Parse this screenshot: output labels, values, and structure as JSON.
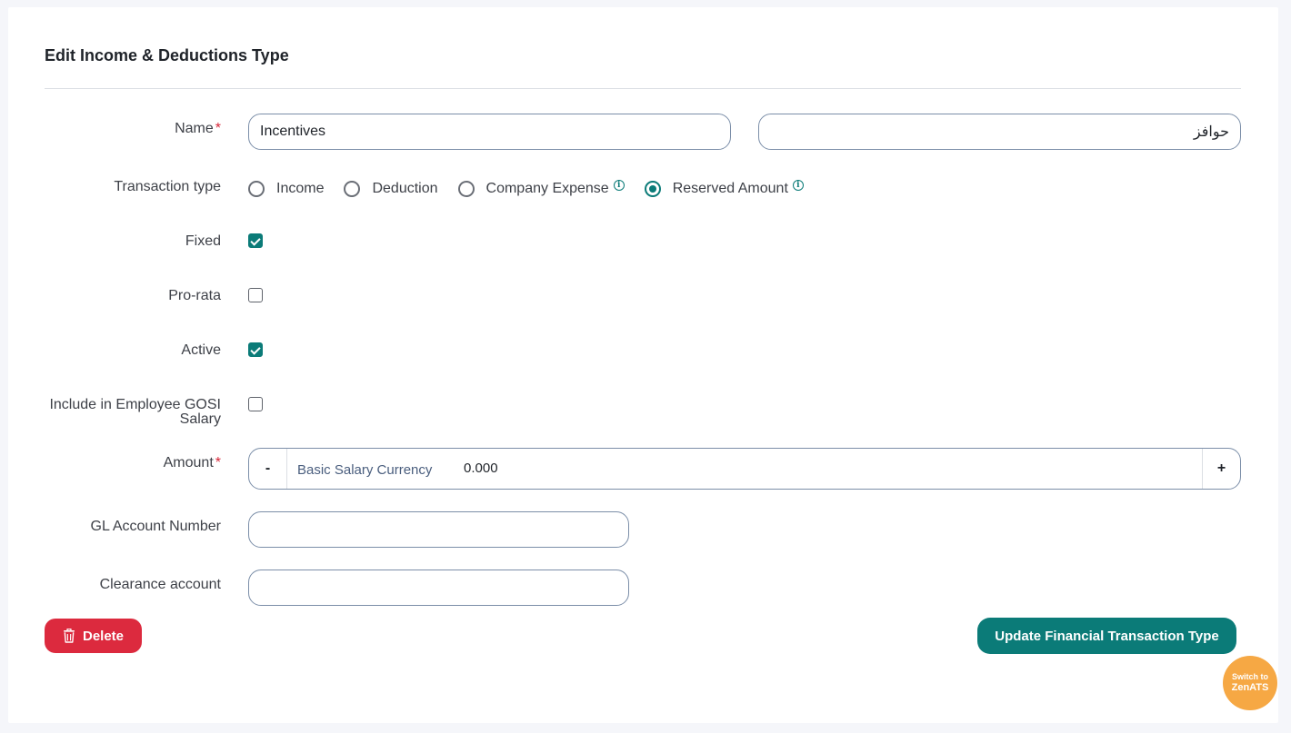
{
  "page": {
    "title": "Edit Income & Deductions Type"
  },
  "form": {
    "name": {
      "label": "Name",
      "required_mark": "*",
      "value_en": "Incentives",
      "value_ar": "حوافز"
    },
    "transaction_type": {
      "label": "Transaction type",
      "options": [
        {
          "label": "Income",
          "selected": false,
          "info": false
        },
        {
          "label": "Deduction",
          "selected": false,
          "info": false
        },
        {
          "label": "Company Expense",
          "selected": false,
          "info": true
        },
        {
          "label": "Reserved Amount",
          "selected": true,
          "info": true
        }
      ]
    },
    "fixed": {
      "label": "Fixed",
      "checked": true
    },
    "pro_rata": {
      "label": "Pro-rata",
      "checked": false
    },
    "active": {
      "label": "Active",
      "checked": true
    },
    "gosi": {
      "label_line1": "Include in Employee GOSI",
      "label_line2": "Salary",
      "checked": false
    },
    "amount": {
      "label": "Amount",
      "required_mark": "*",
      "minus": "-",
      "plus": "+",
      "currency": "Basic Salary Currency",
      "value": "0.000"
    },
    "gl_account": {
      "label": "GL Account Number",
      "value": ""
    },
    "clearance_account": {
      "label": "Clearance account",
      "value": ""
    }
  },
  "actions": {
    "delete_label": "Delete",
    "update_label": "Update Financial Transaction Type"
  },
  "switch_bubble": {
    "line1": "Switch to",
    "line2": "ZenATS"
  },
  "colors": {
    "primary": "#0b7b78",
    "danger": "#dc2a3e",
    "accent": "#f6a844"
  },
  "icons": {
    "delete": "trash-icon",
    "info": "info-icon"
  }
}
